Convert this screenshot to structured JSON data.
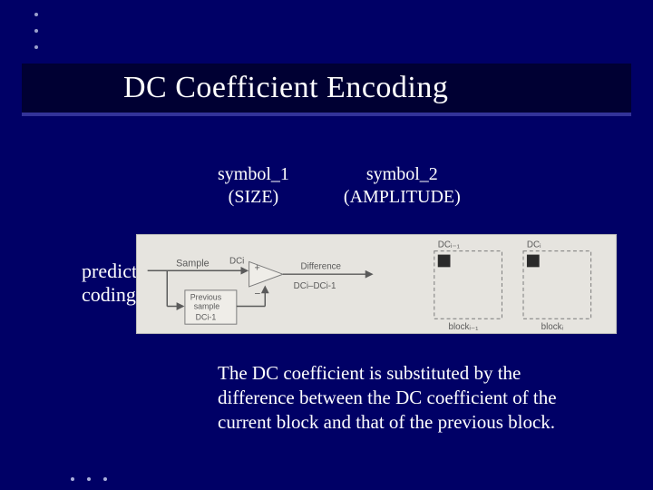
{
  "title": "DC Coefficient Encoding",
  "symbols": {
    "s1_line1": "symbol_1",
    "s1_line2": "(SIZE)",
    "s2_line1": "symbol_2",
    "s2_line2": "(AMPLITUDE)"
  },
  "predictive_label_l1": "predictive",
  "predictive_label_l2": "coding:",
  "body": "The DC coefficient is substituted by the difference between the DC coefficient of the current block and that of the previous block.",
  "diagram": {
    "sample": "Sample",
    "previous_l1": "Previous",
    "previous_l2": "sample",
    "previous_l3": "DCi-1",
    "dci": "DCi",
    "difference": "Difference",
    "diff_out": "DCi–DCi-1",
    "dc_prev": "DCᵢ₋₁",
    "dc_cur": "DCᵢ",
    "block_prev": "blockᵢ₋₁",
    "block_cur": "blockᵢ"
  }
}
